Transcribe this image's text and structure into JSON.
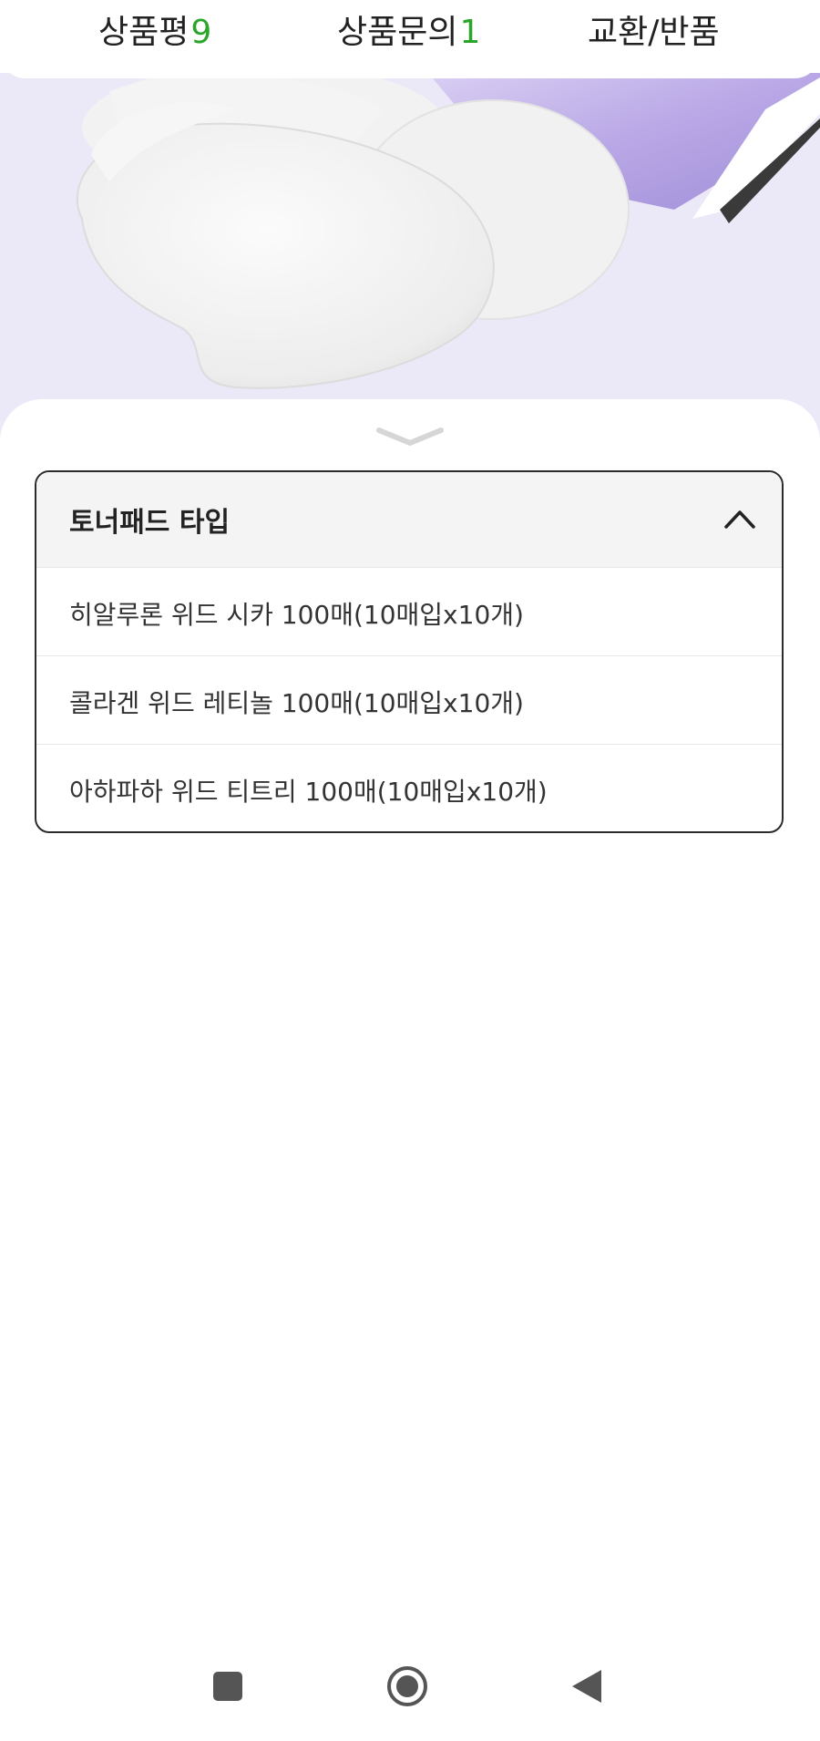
{
  "tabs": {
    "reviews": {
      "label": "상품평",
      "count": "9"
    },
    "inquiries": {
      "label": "상품문의",
      "count": "1"
    },
    "exchange": {
      "label": "교환/반품"
    }
  },
  "dropdown": {
    "title": "토너패드 타입",
    "expanded": true,
    "options": [
      {
        "label": "히알루론 위드 시카 100매(10매입x10개)"
      },
      {
        "label": "콜라겐 위드 레티놀 100매(10매입x10개)"
      },
      {
        "label": "아하파하 위드 티트리 100매(10매입x10개)"
      }
    ]
  },
  "icons": {
    "sheet_handle": "chevron-down-icon",
    "dropdown_toggle": "chevron-up-icon",
    "nav_recents": "square-icon",
    "nav_home": "circle-home-icon",
    "nav_back": "triangle-back-icon"
  },
  "colors": {
    "count_accent": "#2aa52a",
    "hero_background": "#ebe8f7",
    "header_background": "#f4f4f4"
  }
}
